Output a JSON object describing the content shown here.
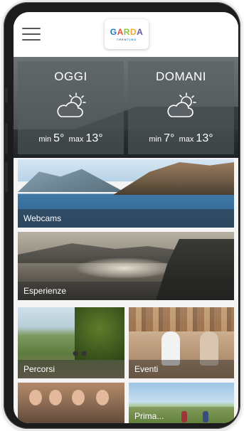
{
  "header": {
    "logo_text": "GARDA",
    "logo_subtext": "TRENTINO"
  },
  "weather": [
    {
      "day": "OGGI",
      "min_label": "min",
      "min": "5°",
      "max_label": "max",
      "max": "13°",
      "icon": "partly-cloudy-icon"
    },
    {
      "day": "DOMANI",
      "min_label": "min",
      "min": "7°",
      "max_label": "max",
      "max": "13°",
      "icon": "partly-cloudy-icon"
    }
  ],
  "tiles": {
    "webcams": "Webcams",
    "esperienze": "Esperienze",
    "percorsi": "Percorsi",
    "eventi": "Eventi",
    "partial": "Prima..."
  },
  "colors": {
    "logo_blue": "#1d7ac0",
    "logo_red": "#e84c3d",
    "logo_green": "#8bc34a",
    "logo_orange": "#f5a623",
    "logo_purple": "#6a4fb3",
    "overlay": "#585e61"
  }
}
